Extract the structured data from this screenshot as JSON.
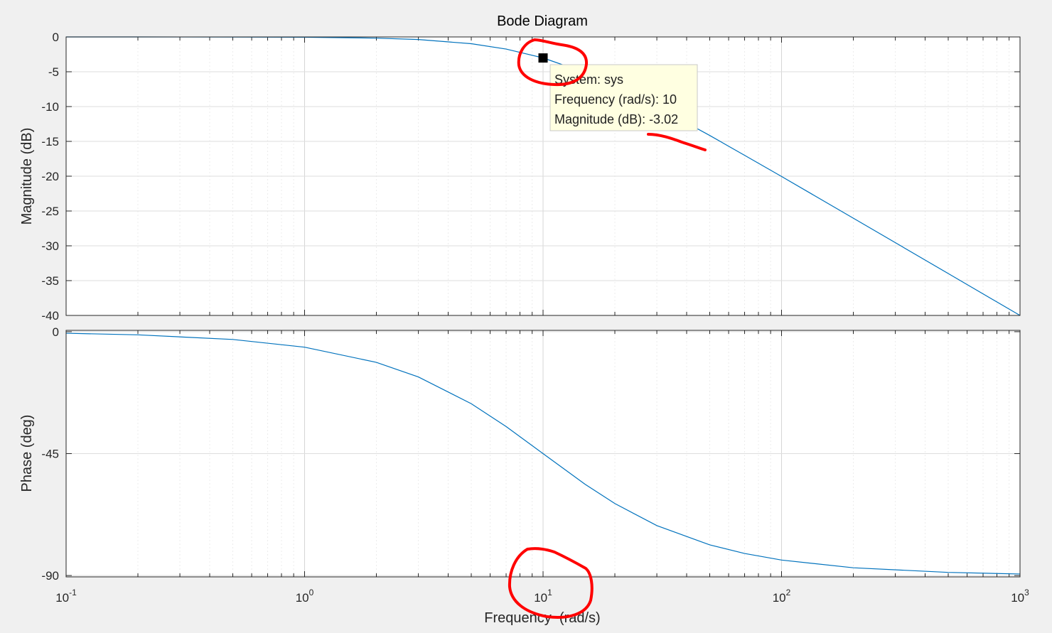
{
  "figure": {
    "title": "Bode Diagram",
    "xlabel": "Frequency  (rad/s)",
    "colors": {
      "background": "#f0f0f0",
      "axes_background": "#ffffff",
      "grid": "#dcdcdc",
      "line": "#0072bd",
      "annotation": "#ff0000",
      "datatip_background": "#ffffe1"
    }
  },
  "chart_data": [
    {
      "type": "line",
      "name": "magnitude",
      "ylabel": "Magnitude (dB)",
      "xscale": "log",
      "xlim": [
        0.1,
        1000
      ],
      "ylim": [
        -40,
        0
      ],
      "yticks": [
        0,
        -5,
        -10,
        -15,
        -20,
        -25,
        -30,
        -35,
        -40
      ],
      "xticks": [
        {
          "base": "10",
          "exp": "-1",
          "value": 0.1
        },
        {
          "base": "10",
          "exp": "0",
          "value": 1
        },
        {
          "base": "10",
          "exp": "1",
          "value": 10
        },
        {
          "base": "10",
          "exp": "2",
          "value": 100
        },
        {
          "base": "10",
          "exp": "3",
          "value": 1000
        }
      ],
      "grid": true,
      "series": [
        {
          "x": [
            0.1,
            0.2,
            0.5,
            1,
            2,
            3,
            5,
            7,
            10,
            15,
            20,
            30,
            50,
            70,
            100,
            200,
            500,
            1000
          ],
          "values": [
            0.0,
            -0.002,
            -0.01,
            -0.04,
            -0.17,
            -0.37,
            -0.97,
            -1.74,
            -3.01,
            -5.12,
            -6.99,
            -10.0,
            -14.15,
            -17.0,
            -20.04,
            -26.03,
            -33.98,
            -40.0
          ]
        }
      ],
      "marker": {
        "x": 10,
        "y": -3.02
      },
      "datatip": {
        "system": "System: sys",
        "frequency": "Frequency (rad/s): 10",
        "magnitude": "Magnitude (dB): -3.02"
      }
    },
    {
      "type": "line",
      "name": "phase",
      "ylabel": "Phase (deg)",
      "xscale": "log",
      "xlim": [
        0.1,
        1000
      ],
      "ylim": [
        -90.5,
        0.5
      ],
      "yticks": [
        0,
        -45,
        -90
      ],
      "xticks": [
        {
          "base": "10",
          "exp": "-1",
          "value": 0.1
        },
        {
          "base": "10",
          "exp": "0",
          "value": 1
        },
        {
          "base": "10",
          "exp": "1",
          "value": 10
        },
        {
          "base": "10",
          "exp": "2",
          "value": 100
        },
        {
          "base": "10",
          "exp": "3",
          "value": 1000
        }
      ],
      "grid": true,
      "series": [
        {
          "x": [
            0.1,
            0.2,
            0.5,
            1,
            2,
            3,
            5,
            7,
            10,
            15,
            20,
            30,
            50,
            70,
            100,
            200,
            500,
            1000
          ],
          "values": [
            -0.57,
            -1.15,
            -2.86,
            -5.71,
            -11.31,
            -16.7,
            -26.57,
            -34.99,
            -45.0,
            -56.31,
            -63.43,
            -71.57,
            -78.69,
            -81.87,
            -84.29,
            -87.14,
            -88.85,
            -89.43
          ]
        }
      ]
    }
  ]
}
